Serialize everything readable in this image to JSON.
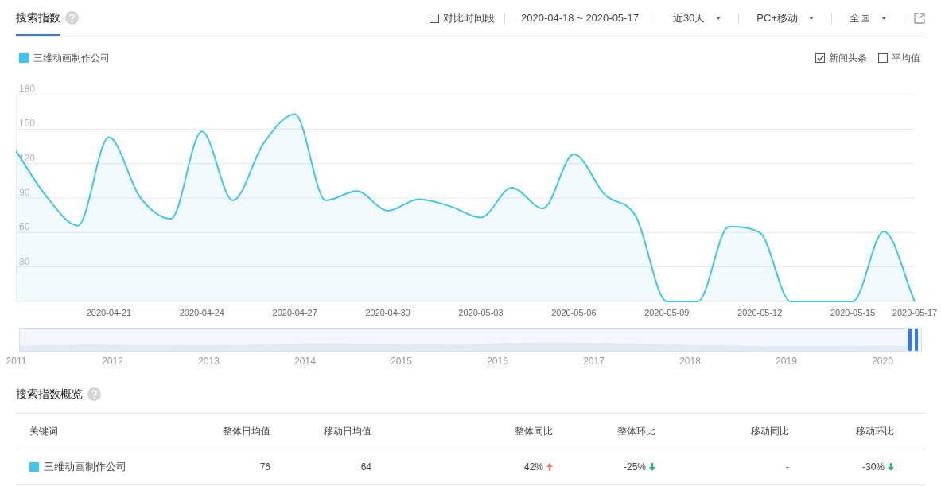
{
  "tabs": [
    {
      "label": "搜索指数",
      "selected": true
    }
  ],
  "toolbar": {
    "compare": {
      "label": "对比时间段",
      "checked": false
    },
    "date_range": "2020-04-18 ~ 2020-05-17",
    "dropdowns": [
      {
        "label": "近30天"
      },
      {
        "label": "PC+移动"
      },
      {
        "label": "全国"
      }
    ]
  },
  "options": [
    {
      "label": "新闻头条",
      "checked": true
    },
    {
      "label": "平均值",
      "checked": false
    }
  ],
  "chart_data": {
    "type": "area",
    "grid": true,
    "categories": [
      null,
      null,
      null,
      "2020-04-21",
      null,
      null,
      "2020-04-24",
      null,
      null,
      "2020-04-27",
      null,
      null,
      "2020-04-30",
      null,
      null,
      "2020-05-03",
      null,
      null,
      "2020-05-06",
      null,
      null,
      "2020-05-09",
      null,
      null,
      "2020-05-12",
      null,
      null,
      "2020-05-15",
      null,
      "2020-05-17"
    ],
    "series": [
      {
        "name": "三维动画制作公司",
        "color": "#3ec6f0",
        "values": [
          131,
          91,
          66,
          143,
          91,
          72,
          148,
          88,
          138,
          163,
          88,
          96,
          79,
          89,
          83,
          73,
          99,
          81,
          128,
          93,
          74,
          0,
          0,
          65,
          60,
          0,
          0,
          0,
          61,
          0
        ]
      }
    ],
    "ylim": [
      0,
      180
    ],
    "yticks": [
      30,
      60,
      90,
      120,
      150,
      180
    ]
  },
  "navigator": {
    "years": [
      "2011",
      "2012",
      "2013",
      "2014",
      "2015",
      "2016",
      "2017",
      "2018",
      "2019",
      "2020"
    ]
  },
  "overview": {
    "title": "搜索指数概览",
    "columns": [
      "关键词",
      "整体日均值",
      "移动日均值",
      "整体同比",
      "整体环比",
      "移动同比",
      "移动环比"
    ],
    "rows": [
      {
        "cells": [
          {
            "text": "三维动画制作公司",
            "color": "#3ec6f0"
          },
          {
            "text": "76"
          },
          {
            "text": "64"
          },
          {
            "text": "42%",
            "kind": "rise"
          },
          {
            "text": "-25%",
            "kind": "fall"
          },
          {
            "text": "-"
          },
          {
            "text": "-30%",
            "kind": "fall"
          }
        ]
      }
    ]
  }
}
